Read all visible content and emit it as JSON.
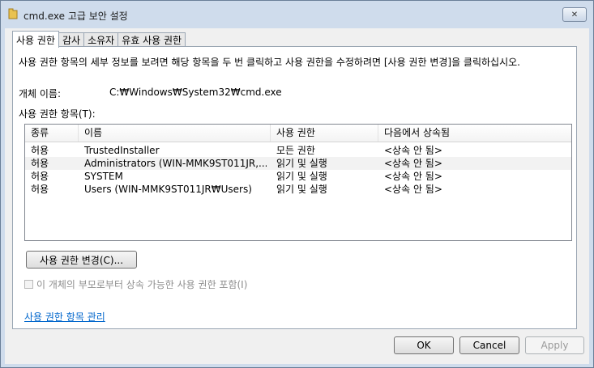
{
  "window": {
    "title": "cmd.exe 고급 보안 설정",
    "close_glyph": "✕"
  },
  "tabs": [
    {
      "label": "사용 권한",
      "active": true
    },
    {
      "label": "감사"
    },
    {
      "label": "소유자"
    },
    {
      "label": "유효 사용 권한"
    }
  ],
  "panel": {
    "description": "사용 권한 항목의 세부 정보를 보려면 해당 항목을 두 번 클릭하고 사용 권한을 수정하려면 [사용 권한 변경]을 클릭하십시오.",
    "object_name_label": "개체 이름:",
    "object_name_value": "C:₩Windows₩System32₩cmd.exe",
    "entries_label": "사용 권한 항목(T):",
    "columns": [
      "종류",
      "이름",
      "사용 권한",
      "다음에서 상속됨"
    ],
    "rows": [
      {
        "type": "허용",
        "name": "TrustedInstaller",
        "permission": "모든 권한",
        "inherited": "<상속 안 됨>"
      },
      {
        "type": "허용",
        "name": "Administrators (WIN-MMK9ST011JR,...",
        "permission": "읽기 및 실행",
        "inherited": "<상속 안 됨>"
      },
      {
        "type": "허용",
        "name": "SYSTEM",
        "permission": "읽기 및 실행",
        "inherited": "<상속 안 됨>"
      },
      {
        "type": "허용",
        "name": "Users (WIN-MMK9ST011JR₩Users)",
        "permission": "읽기 및 실행",
        "inherited": "<상속 안 됨>"
      }
    ],
    "change_button": "사용 권한 변경(C)...",
    "inherit_checkbox": {
      "label": "이 개체의 부모로부터 상속 가능한 사용 권한 포함(I)",
      "checked": false,
      "enabled": false
    },
    "manage_link": "사용 권한 항목 관리"
  },
  "buttons": {
    "ok": "OK",
    "cancel": "Cancel",
    "apply": "Apply"
  },
  "colors": {
    "link": "#0066cc",
    "window_frame": "#cfdcec",
    "disabled_text": "#8d8d8d"
  }
}
